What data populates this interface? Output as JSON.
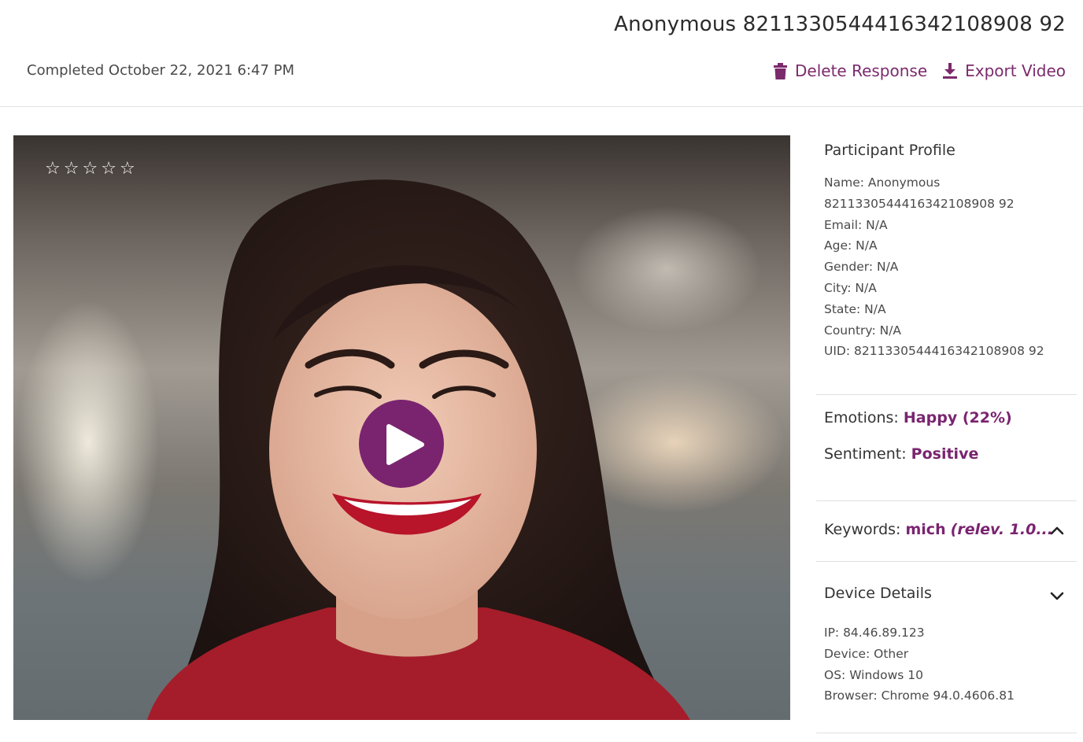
{
  "header": {
    "title": "Anonymous 8211330544416342108908 92",
    "completed": "Completed October 22, 2021 6:47 PM",
    "delete_label": "Delete Response",
    "export_label": "Export Video"
  },
  "video": {
    "rating": 0,
    "rating_max": 5,
    "stars": [
      "☆",
      "☆",
      "☆",
      "☆",
      "☆"
    ],
    "play_icon": "play-icon",
    "accent": "#7a2470"
  },
  "profile": {
    "title": "Participant Profile",
    "lines": [
      "Name: Anonymous",
      "8211330544416342108908 92",
      "Email: N/A",
      "Age: N/A",
      "Gender: N/A",
      "City: N/A",
      "State: N/A",
      "Country: N/A",
      "UID: 8211330544416342108908 92"
    ]
  },
  "analysis": {
    "emotions_label": "Emotions:",
    "emotions_value": "Happy (22%)",
    "sentiment_label": "Sentiment:",
    "sentiment_value": "Positive"
  },
  "keywords": {
    "label": "Keywords:",
    "value": "mich",
    "relevance": "(relev. 1.0...",
    "expanded_icon": "chevron-up-icon"
  },
  "device": {
    "title": "Device Details",
    "expanded_icon": "chevron-down-icon",
    "lines": [
      "IP: 84.46.89.123",
      "Device: Other",
      "OS: Windows 10",
      "Browser: Chrome 94.0.4606.81"
    ]
  },
  "colors": {
    "accent": "#7a2470",
    "text": "#333333",
    "divider": "#e0e0e0"
  }
}
